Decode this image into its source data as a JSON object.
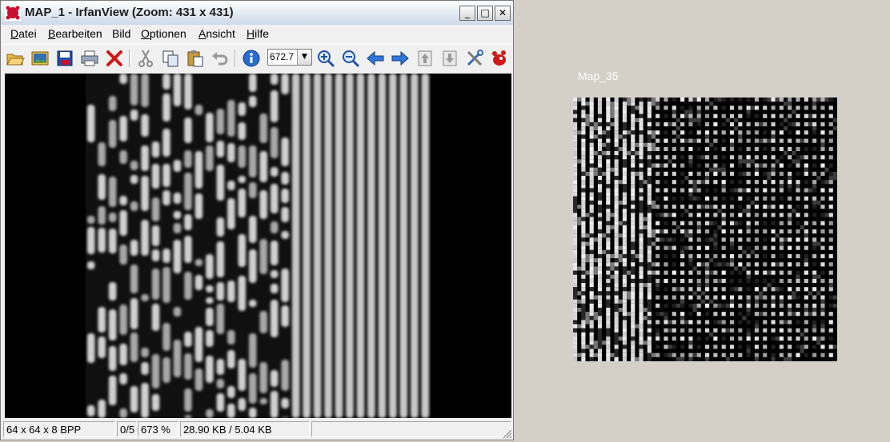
{
  "window": {
    "title": "MAP_1 - IrfanView (Zoom: 431 x 431)",
    "controls": {
      "minimize": "_",
      "maximize": "□",
      "close": "✕"
    }
  },
  "menu": [
    {
      "label": "Datei",
      "accel": "D",
      "rest": "atei"
    },
    {
      "label": "Bearbeiten",
      "accel": "B",
      "rest": "earbeiten"
    },
    {
      "label": "Bild",
      "accel": "B",
      "rest": "ild"
    },
    {
      "label": "Optionen",
      "accel": "O",
      "rest": "ptionen"
    },
    {
      "label": "Ansicht",
      "accel": "A",
      "rest": "nsicht"
    },
    {
      "label": "Hilfe",
      "accel": "H",
      "rest": "ilfe"
    }
  ],
  "toolbar": {
    "icons": [
      "open-folder-icon",
      "thumbnails-icon",
      "save-icon",
      "print-icon",
      "delete-icon",
      "cut-icon",
      "copy-icon",
      "paste-icon",
      "undo-icon",
      "info-icon",
      "zoom-in-icon",
      "zoom-out-icon",
      "previous-arrow-icon",
      "next-arrow-icon",
      "page-up-icon",
      "page-down-icon",
      "settings-tools-icon",
      "irfanview-logo-icon"
    ],
    "zoom_value": "672.7"
  },
  "status": {
    "image_info": "64 x 64 x 8 BPP",
    "index": "0/5",
    "zoom_percent": "673 %",
    "file_size": "28.90 KB / 5.04 KB"
  },
  "preview": {
    "label": "Map_35"
  }
}
